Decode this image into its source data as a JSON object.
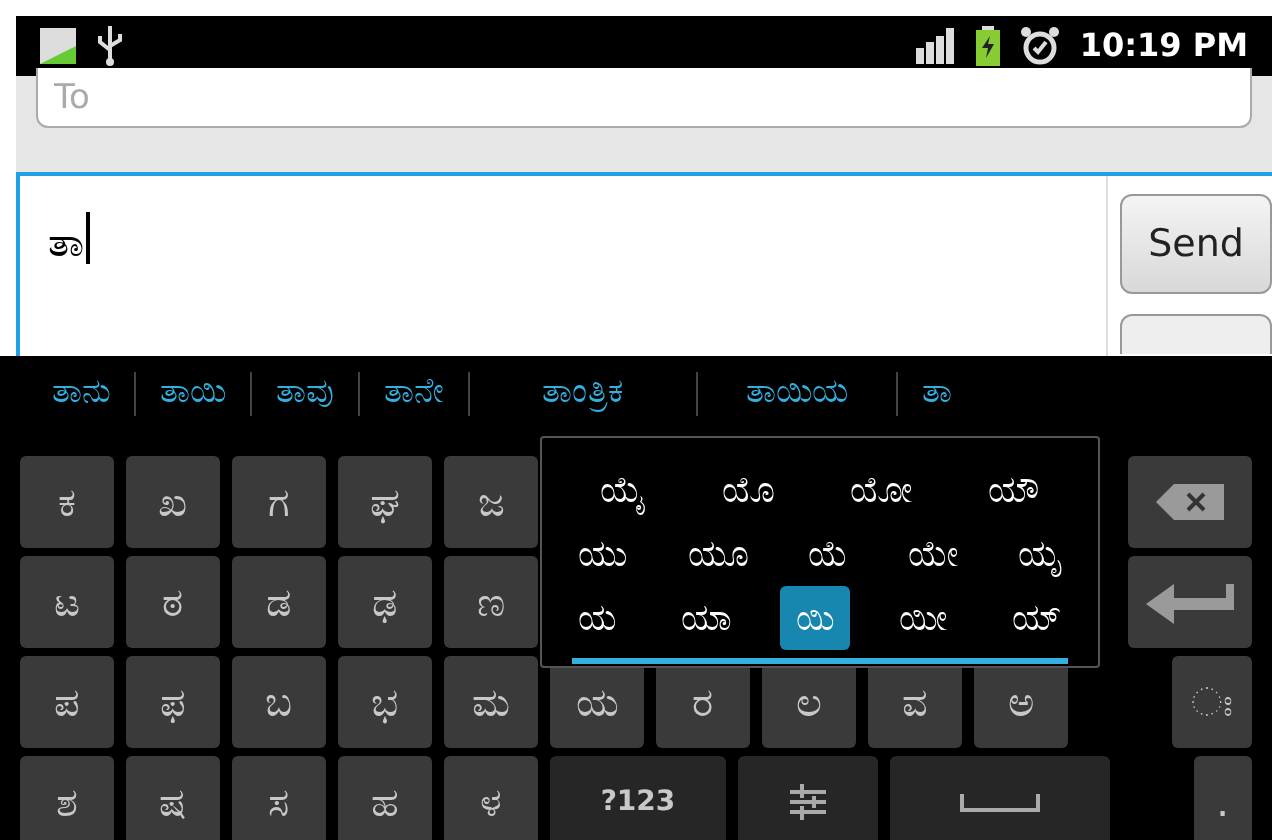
{
  "status_bar": {
    "time": "10:19 PM"
  },
  "to_field": {
    "placeholder": "To"
  },
  "message_field": {
    "value": "ತಾ"
  },
  "send_button": "Send",
  "suggestions": [
    "ತಾನು",
    "ತಾಯಿ",
    "ತಾವು",
    "ತಾನೇ",
    "ತಾಂತ್ರಿಕ",
    "ತಾಯಿಯ",
    "ತಾ"
  ],
  "keyboard": {
    "rows": [
      {
        "left": [
          {
            "kind": "char",
            "label": "ಕ"
          },
          {
            "kind": "char",
            "label": "ಖ"
          },
          {
            "kind": "char",
            "label": "ಗ"
          },
          {
            "kind": "char",
            "label": "ಘ"
          },
          {
            "kind": "char",
            "label": "ಜ"
          }
        ],
        "right": [
          {
            "kind": "backspace"
          }
        ]
      },
      {
        "left": [
          {
            "kind": "char",
            "label": "ಟ"
          },
          {
            "kind": "char",
            "label": "ಠ"
          },
          {
            "kind": "char",
            "label": "ಡ"
          },
          {
            "kind": "char",
            "label": "ಢ"
          },
          {
            "kind": "char",
            "label": "ಣ"
          }
        ],
        "right": [
          {
            "kind": "enter"
          }
        ]
      },
      {
        "left": [
          {
            "kind": "char",
            "label": "ಪ"
          },
          {
            "kind": "char",
            "label": "ಫ"
          },
          {
            "kind": "char",
            "label": "ಬ"
          },
          {
            "kind": "char",
            "label": "ಭ"
          },
          {
            "kind": "char",
            "label": "ಮ"
          },
          {
            "kind": "char",
            "label": "ಯ"
          },
          {
            "kind": "char",
            "label": "ರ"
          },
          {
            "kind": "char",
            "label": "ಲ"
          },
          {
            "kind": "char",
            "label": "ವ"
          },
          {
            "kind": "char",
            "label": "ಅ"
          }
        ],
        "right": [
          {
            "kind": "char",
            "label": "ಃ"
          }
        ]
      },
      {
        "left": [
          {
            "kind": "char",
            "label": "ಶ"
          },
          {
            "kind": "char",
            "label": "ಷ"
          },
          {
            "kind": "char",
            "label": "ಸ"
          },
          {
            "kind": "char",
            "label": "ಹ"
          },
          {
            "kind": "char",
            "label": "ಳ"
          },
          {
            "kind": "symbols",
            "label": "?123"
          },
          {
            "kind": "settings"
          },
          {
            "kind": "space"
          }
        ],
        "right": [
          {
            "kind": "char",
            "label": "."
          }
        ]
      }
    ]
  },
  "variant_popup": {
    "rows": [
      [
        {
          "label": "ಯೈ",
          "selected": false
        },
        {
          "label": "ಯೊ",
          "selected": false
        },
        {
          "label": "ಯೋ",
          "selected": false
        },
        {
          "label": "ಯೌ",
          "selected": false
        }
      ],
      [
        {
          "label": "ಯು",
          "selected": false
        },
        {
          "label": "ಯೂ",
          "selected": false
        },
        {
          "label": "ಯೆ",
          "selected": false
        },
        {
          "label": "ಯೇ",
          "selected": false
        },
        {
          "label": "ಯೃ",
          "selected": false
        }
      ],
      [
        {
          "label": "ಯ",
          "selected": false
        },
        {
          "label": "ಯಾ",
          "selected": false
        },
        {
          "label": "ಯಿ",
          "selected": true
        },
        {
          "label": "ಯೀ",
          "selected": false
        },
        {
          "label": "ಯ್",
          "selected": false
        }
      ]
    ]
  }
}
